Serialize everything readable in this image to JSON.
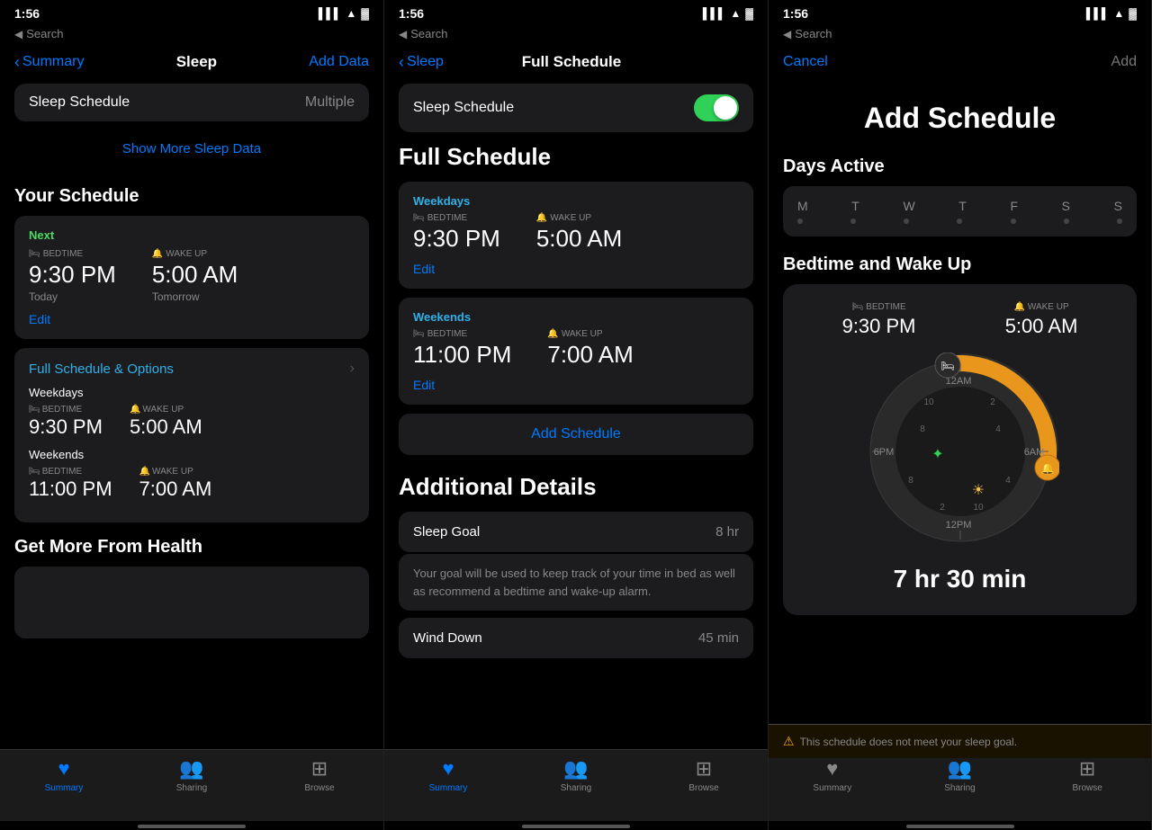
{
  "panels": [
    {
      "id": "panel1",
      "statusBar": {
        "time": "1:56",
        "hasSignal": true,
        "hasWifi": true,
        "hasBattery": true,
        "searchText": "Search"
      },
      "navBar": {
        "backLabel": "Summary",
        "title": "Sleep",
        "actionLabel": "Add Data"
      },
      "sleepSchedule": {
        "label": "Sleep Schedule",
        "value": "Multiple"
      },
      "showMoreLink": "Show More Sleep Data",
      "yourSchedule": {
        "heading": "Your Schedule",
        "nextCard": {
          "nextLabel": "Next",
          "bedtimeLabel": "BEDTIME",
          "wakeLabel": "WAKE UP",
          "bedtimeIcon": "🛏",
          "wakeIcon": "🔔",
          "bedtimeTime": "9:30 PM",
          "wakeTime": "5:00 AM",
          "bedtimeSub": "Today",
          "wakeSub": "Tomorrow",
          "editLabel": "Edit"
        },
        "fullScheduleCard": {
          "title": "Full Schedule & Options",
          "weekdays": {
            "label": "Weekdays",
            "bedtimeLabel": "BEDTIME",
            "wakeLabel": "WAKE UP",
            "bedtimeTime": "9:30 PM",
            "wakeTime": "5:00 AM"
          },
          "weekends": {
            "label": "Weekends",
            "bedtimeLabel": "BEDTIME",
            "wakeLabel": "WAKE UP",
            "bedtimeTime": "11:00 PM",
            "wakeTime": "7:00 AM"
          }
        }
      },
      "getMoreSection": {
        "heading": "Get More From Health"
      },
      "tabBar": {
        "items": [
          {
            "icon": "♥",
            "label": "Summary",
            "active": true
          },
          {
            "icon": "👥",
            "label": "Sharing",
            "active": false
          },
          {
            "icon": "⊞",
            "label": "Browse",
            "active": false
          }
        ]
      }
    },
    {
      "id": "panel2",
      "statusBar": {
        "time": "1:56",
        "searchText": "Search"
      },
      "navBar": {
        "backLabel": "Sleep",
        "title": "Full Schedule",
        "actionLabel": ""
      },
      "sleepSchedule": {
        "label": "Sleep Schedule",
        "enabled": true
      },
      "fullScheduleSection": {
        "heading": "Full Schedule",
        "weekdays": {
          "label": "Weekdays",
          "bedtimeLabel": "BEDTIME",
          "wakeLabel": "WAKE UP",
          "bedtimeTime": "9:30 PM",
          "wakeTime": "5:00 AM",
          "editLabel": "Edit"
        },
        "weekends": {
          "label": "Weekends",
          "bedtimeLabel": "BEDTIME",
          "wakeLabel": "WAKE UP",
          "bedtimeTime": "11:00 PM",
          "wakeTime": "7:00 AM",
          "editLabel": "Edit"
        },
        "addScheduleLabel": "Add Schedule"
      },
      "additionalDetails": {
        "heading": "Additional Details",
        "sleepGoal": {
          "label": "Sleep Goal",
          "value": "8 hr"
        },
        "sleepGoalDescription": "Your goal will be used to keep track of your time in bed as well as recommend a bedtime and wake-up alarm.",
        "windDown": {
          "label": "Wind Down",
          "value": "45 min"
        }
      },
      "tabBar": {
        "items": [
          {
            "icon": "♥",
            "label": "Summary",
            "active": true
          },
          {
            "icon": "👥",
            "label": "Sharing",
            "active": false
          },
          {
            "icon": "⊞",
            "label": "Browse",
            "active": false
          }
        ]
      }
    },
    {
      "id": "panel3",
      "statusBar": {
        "time": "1:56",
        "searchText": "Search"
      },
      "navBar": {
        "cancelLabel": "Cancel",
        "addLabel": "Add"
      },
      "title": "Add Schedule",
      "daysActive": {
        "heading": "Days Active",
        "days": [
          "M",
          "T",
          "W",
          "T",
          "F",
          "S",
          "S"
        ]
      },
      "bedtimeWakeUp": {
        "heading": "Bedtime and Wake Up",
        "bedtimeLabel": "BEDTIME",
        "wakeLabel": "WAKE UP",
        "bedtimeIcon": "🛏",
        "wakeIcon": "🔔",
        "bedtimeTime": "9:30 PM",
        "wakeTime": "5:00 AM",
        "clockLabels": {
          "am12": "12AM",
          "pm6": "6PM",
          "am6": "6AM",
          "pm12": "12PM",
          "n2left": "2",
          "n4left": "4",
          "n8left": "8",
          "n10left": "10",
          "n2right": "2",
          "n4right": "4",
          "n8right": "8",
          "n10right": "10"
        }
      },
      "duration": "7 hr 30 min",
      "scheduleNote": "This schedule does not meet your sleep goal.",
      "tabBar": {
        "items": [
          {
            "icon": "♥",
            "label": "Summary",
            "active": false
          },
          {
            "icon": "👥",
            "label": "Sharing",
            "active": false
          },
          {
            "icon": "⊞",
            "label": "Browse",
            "active": false
          }
        ]
      }
    }
  ]
}
